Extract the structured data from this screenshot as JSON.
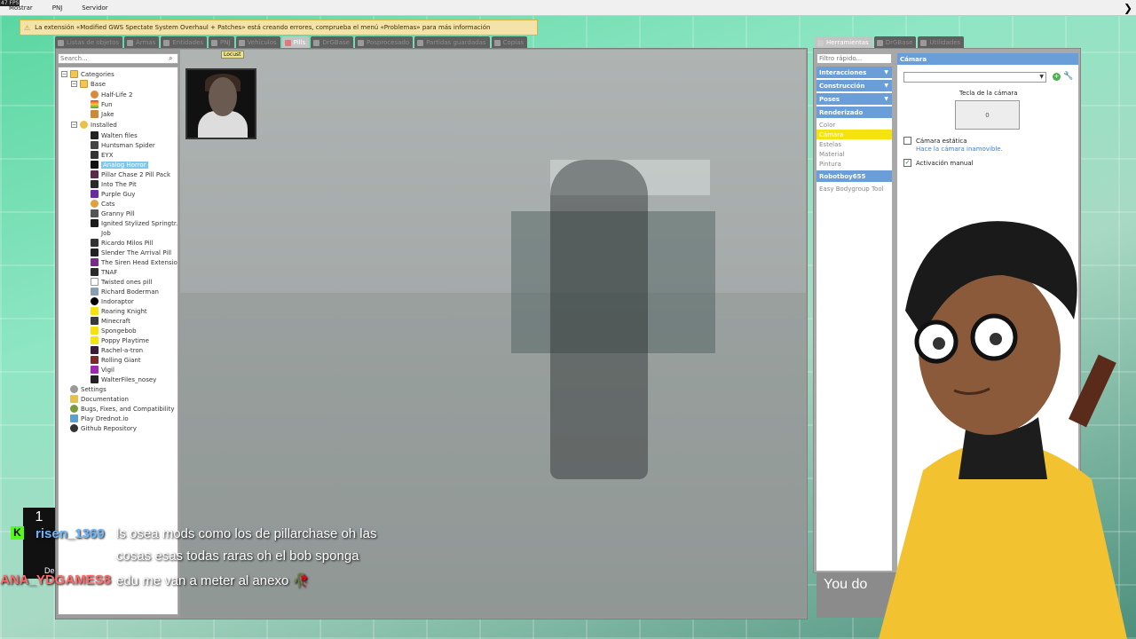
{
  "fps": "47 FPS",
  "menubar": {
    "items": [
      "Mostrar",
      "PNJ",
      "Servidor"
    ]
  },
  "warning": "La extensión «Modified GWS Spectate System Overhaul + Patches» está creando errores, comprueba el menú «Problemas» para más información",
  "spawn_tabs": [
    "Listas de objetos",
    "Armas",
    "Entidades",
    "PNJ",
    "Vehículos",
    "Pills",
    "DrGBase",
    "Posprocesado",
    "Partidas guardadas",
    "Copias"
  ],
  "search_placeholder": "Search...",
  "tooltip": "Locust",
  "tree": {
    "categories": "Categories",
    "base": "Base",
    "base_items": [
      "Half-Life 2",
      "Fun",
      "Jake"
    ],
    "installed": "Installed",
    "installed_items": [
      "Walten files",
      "Huntsman Spider",
      "EYX",
      "Analog Horror",
      "Pillar Chase 2 Pill Pack",
      "Into The Pit",
      "Purple Guy",
      "Cats",
      "Granny Pill",
      "Ignited Stylized Springtr...",
      "Job",
      "Ricardo Milos Pill",
      "Slender The Arrival Pill",
      "The Siren Head Extensio...",
      "TNAF",
      "Twisted ones pill",
      "Richard Boderman",
      "Indoraptor",
      "Roaring Knight",
      "Minecraft",
      "Spongebob",
      "Poppy Playtime",
      "Rachel-a-tron",
      "Rolling Giant",
      "Vigil",
      "WalterFiles_nosey"
    ],
    "footer": [
      "Settings",
      "Documentation",
      "Bugs, Fixes, and Compatibility",
      "Play Drednot.io",
      "Github Repository"
    ]
  },
  "tool_tabs": [
    "Herramientas",
    "DrGBase",
    "Utilidades"
  ],
  "filter_placeholder": "Filtro rápido...",
  "tool_cats": [
    "Interacciones",
    "Construcción",
    "Poses",
    "Renderizado"
  ],
  "render_items": [
    "Color",
    "Cámara",
    "Estelas",
    "Material",
    "Pintura"
  ],
  "robotboy": "Robotboy655",
  "easy_bodygroup": "Easy Bodygroup Tool",
  "camera": {
    "title": "Cámara",
    "key_label": "Tecla de la cámara",
    "key_value": "0",
    "static_label": "Cámara estática",
    "static_hint": "Hace la cámara inamovible.",
    "manual_label": "Activación manual"
  },
  "chat": {
    "count": "1",
    "user1": "risen_1369",
    "line1": "ls osea mods como los de pillarchase oh las",
    "line2": "cosas esas todas raras oh el bob sponga",
    "user2": "ANA_YDGAMES8",
    "line3": "edu me van a meter al anexo 🥀",
    "frag": "De"
  },
  "you_do": "You do"
}
